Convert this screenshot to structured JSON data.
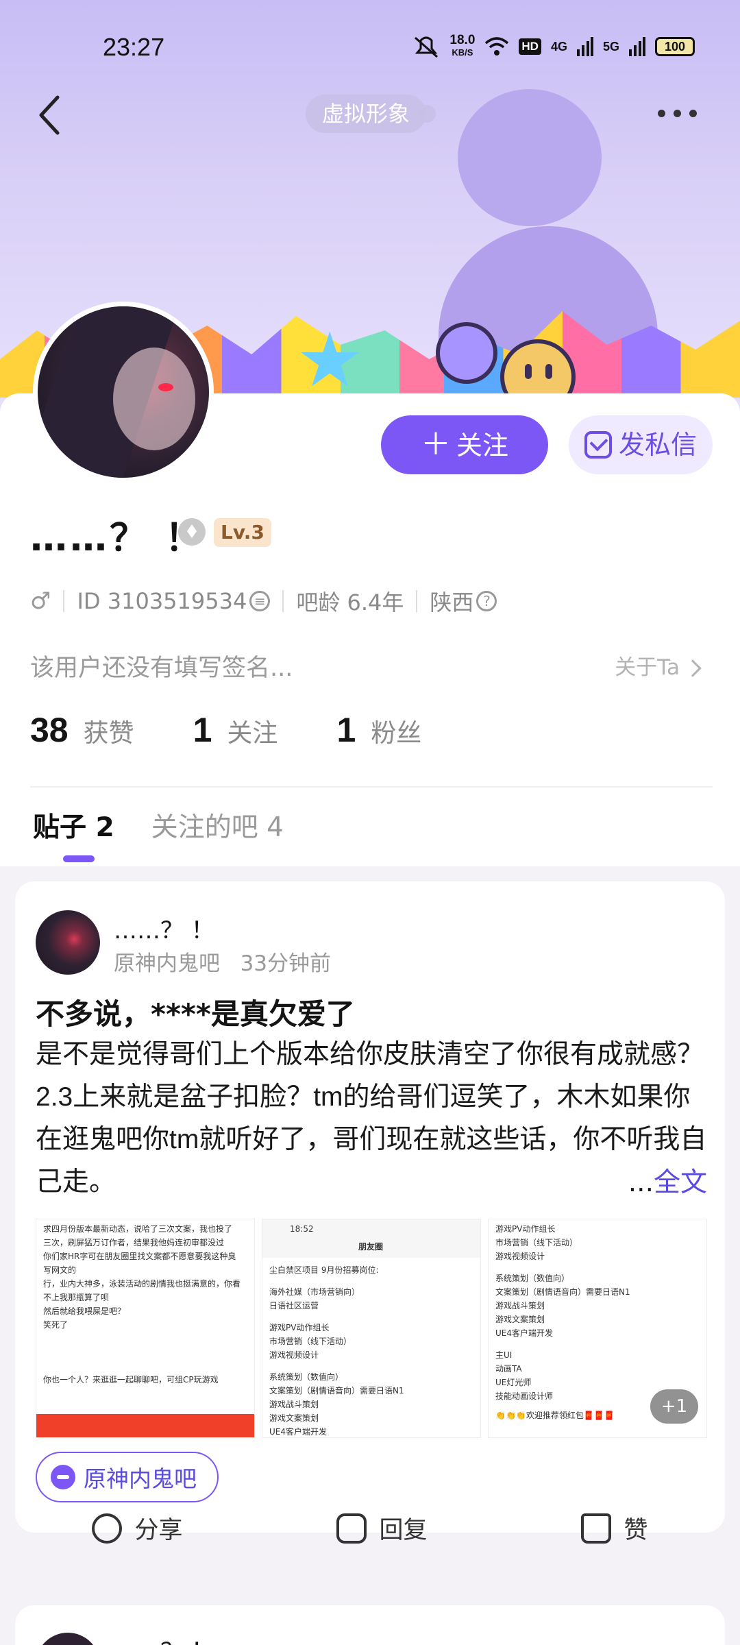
{
  "status_bar": {
    "time": "23:27",
    "net_speed_value": "18.0",
    "net_speed_unit": "KB/S",
    "hd_label": "HD",
    "net_4g": "4G",
    "net_5g": "5G",
    "battery": "100"
  },
  "header": {
    "virtual_tag": "虚拟形象"
  },
  "profile": {
    "follow_label": "关注",
    "message_label": "发私信",
    "username": "……？ ！",
    "level": "Lv.3",
    "id_text": "ID 3103519534",
    "bar_age": "吧龄 6.4年",
    "location": "陕西",
    "signature": "该用户还没有填写签名...",
    "about_label": "关于Ta",
    "stats": [
      {
        "num": "38",
        "label": "获赞"
      },
      {
        "num": "1",
        "label": "关注"
      },
      {
        "num": "1",
        "label": "粉丝"
      }
    ]
  },
  "tabs": [
    {
      "label": "贴子 2"
    },
    {
      "label": "关注的吧 4"
    }
  ],
  "post": {
    "username": "……？ ！",
    "forum": "原神内鬼吧",
    "time": "33分钟前",
    "title": "不多说，****⁠是真欠爱了",
    "body": "是不是觉得哥们上个版本给你皮肤清空了你很有成就感？2.3上来就是⁠盆子扣脸？tm的给哥们逗笑了，木木如果你在逛鬼吧你tm就听好了，哥们现在就这些话，你不听我自己走。",
    "full_text_dots": "...",
    "full_text_label": "全文",
    "thumb1_lines": [
      "求四月份版本最新动态，说哈了三次文案，我也投了",
      "三次，刷屏猛万订作者，结果我他妈连初审都没过",
      "你们家HR字可在朋友圈里找文案都不愿意要我这种臭",
      "写网文的",
      "行，业内大神多，泳装活动的剧情我也挺满意的，你看",
      "不上我那瓶算了呗",
      "然后就给我喂屎是吧？",
      "笑死了"
    ],
    "thumb1_footer": "你也一个人？来逛逛一起聊聊吧，可组CP玩游戏",
    "thumb2_lines": [
      "尘白禁区项目 9月份招募岗位:",
      "海外社媒（市场营销向）",
      "日语社区运营",
      "游戏PV动作组长",
      "市场营销（线下活动）",
      "游戏视频设计",
      "系统策划（数值向）",
      "文案策划（剧情语音向）需要日语N1",
      "游戏战斗策划",
      "游戏文案策划",
      "UE4客户端开发"
    ],
    "thumb2_time": "18:52",
    "thumb2_header": "朋友圈",
    "thumb3_lines": [
      "游戏PV动作组长",
      "市场营销（线下活动）",
      "游戏视频设计",
      "系统策划（数值向）",
      "文案策划（剧情语音向）需要日语N1",
      "游戏战斗策划",
      "游戏文案策划",
      "UE4客户端开发",
      "主UI",
      "动画TA",
      "UE灯光师",
      "技能动画设计师",
      "👏👏👏欢迎推荐领红包🧧🧧🧧"
    ],
    "more_images": "+1",
    "forum_chip": "原神内鬼吧",
    "actions": [
      {
        "label": "分享",
        "icon": "share-icon"
      },
      {
        "label": "回复",
        "icon": "comment-icon"
      },
      {
        "label": "赞",
        "icon": "like-icon"
      }
    ]
  },
  "post2": {
    "username": "……？ ！"
  },
  "colors": {
    "accent": "#7c57f5",
    "accent_light": "#efeaff",
    "link": "#5a4be0"
  }
}
